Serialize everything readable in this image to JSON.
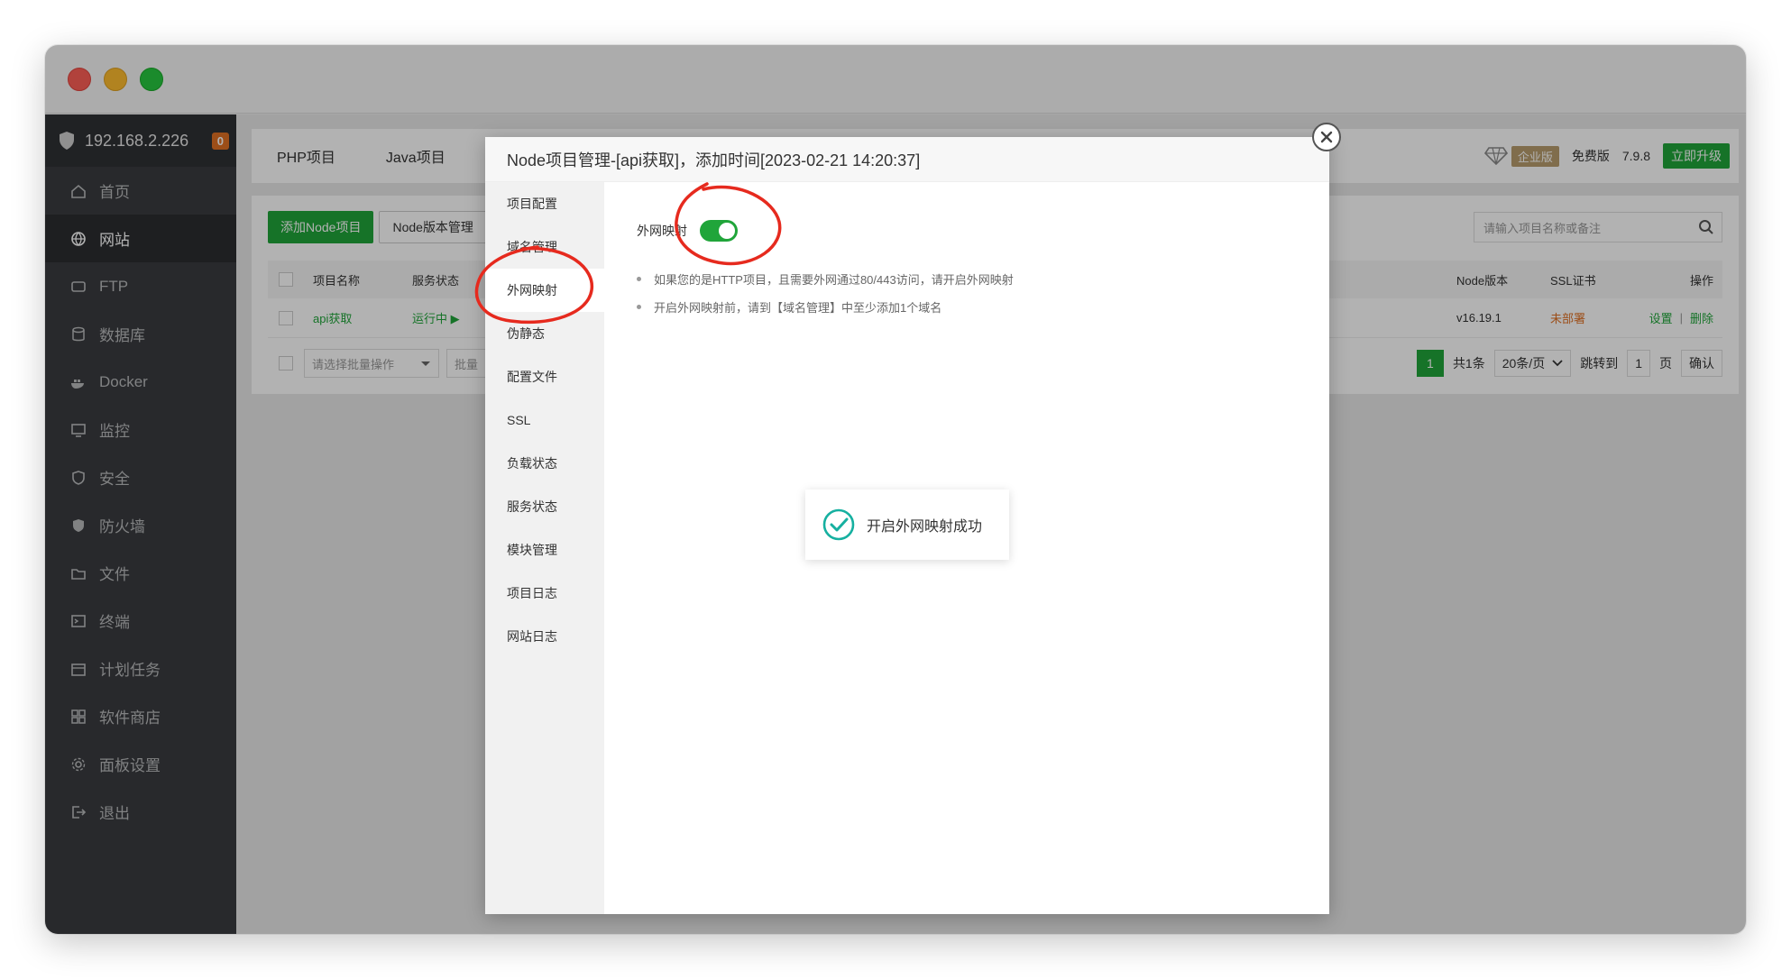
{
  "sidebar": {
    "ip": "192.168.2.226",
    "badge": "0",
    "items": [
      {
        "label": "首页",
        "icon": "home-icon"
      },
      {
        "label": "网站",
        "icon": "globe-icon"
      },
      {
        "label": "FTP",
        "icon": "ftp-icon"
      },
      {
        "label": "数据库",
        "icon": "database-icon"
      },
      {
        "label": "Docker",
        "icon": "docker-icon"
      },
      {
        "label": "监控",
        "icon": "monitor-icon"
      },
      {
        "label": "安全",
        "icon": "shield-icon"
      },
      {
        "label": "防火墙",
        "icon": "firewall-icon"
      },
      {
        "label": "文件",
        "icon": "folder-icon"
      },
      {
        "label": "终端",
        "icon": "terminal-icon"
      },
      {
        "label": "计划任务",
        "icon": "calendar-icon"
      },
      {
        "label": "软件商店",
        "icon": "apps-icon"
      },
      {
        "label": "面板设置",
        "icon": "gear-icon"
      },
      {
        "label": "退出",
        "icon": "logout-icon"
      }
    ]
  },
  "topbar": {
    "tabs": [
      "PHP项目",
      "Java项目"
    ],
    "enterprise": "企业版",
    "free": "免费版",
    "version": "7.9.8",
    "upgrade": "立即升级"
  },
  "content": {
    "add_button": "添加Node项目",
    "version_button": "Node版本管理",
    "search_placeholder": "请输入项目名称或备注",
    "headers": {
      "name": "项目名称",
      "status": "服务状态",
      "node_version": "Node版本",
      "ssl": "SSL证书",
      "ops": "操作"
    },
    "row": {
      "name": "api获取",
      "status": "运行中 ▶",
      "node_version": "v16.19.1",
      "ssl": "未部署",
      "set": "设置",
      "sep": "|",
      "delete": "删除"
    },
    "batch_select": "请选择批量操作",
    "batch_btn": "批量",
    "pager": {
      "page": "1",
      "total": "共1条",
      "per_page": "20条/页",
      "jump": "跳转到",
      "jump_value": "1",
      "page_unit": "页",
      "confirm": "确认"
    }
  },
  "modal": {
    "title": "Node项目管理-[api获取]，添加时间[2023-02-21 14:20:37]",
    "nav": [
      "项目配置",
      "域名管理",
      "外网映射",
      "伪静态",
      "配置文件",
      "SSL",
      "负载状态",
      "服务状态",
      "模块管理",
      "项目日志",
      "网站日志"
    ],
    "active_nav": 2,
    "toggle_label": "外网映射",
    "toggle_on": true,
    "tips": [
      "如果您的是HTTP项目，且需要外网通过80/443访问，请开启外网映射",
      "开启外网映射前，请到【域名管理】中至少添加1个域名"
    ]
  },
  "toast": {
    "message": "开启外网映射成功"
  },
  "colors": {
    "accent": "#20a53a",
    "sidebar": "#3a3c40",
    "annotation": "#e62a1e",
    "warn": "#e07023"
  }
}
